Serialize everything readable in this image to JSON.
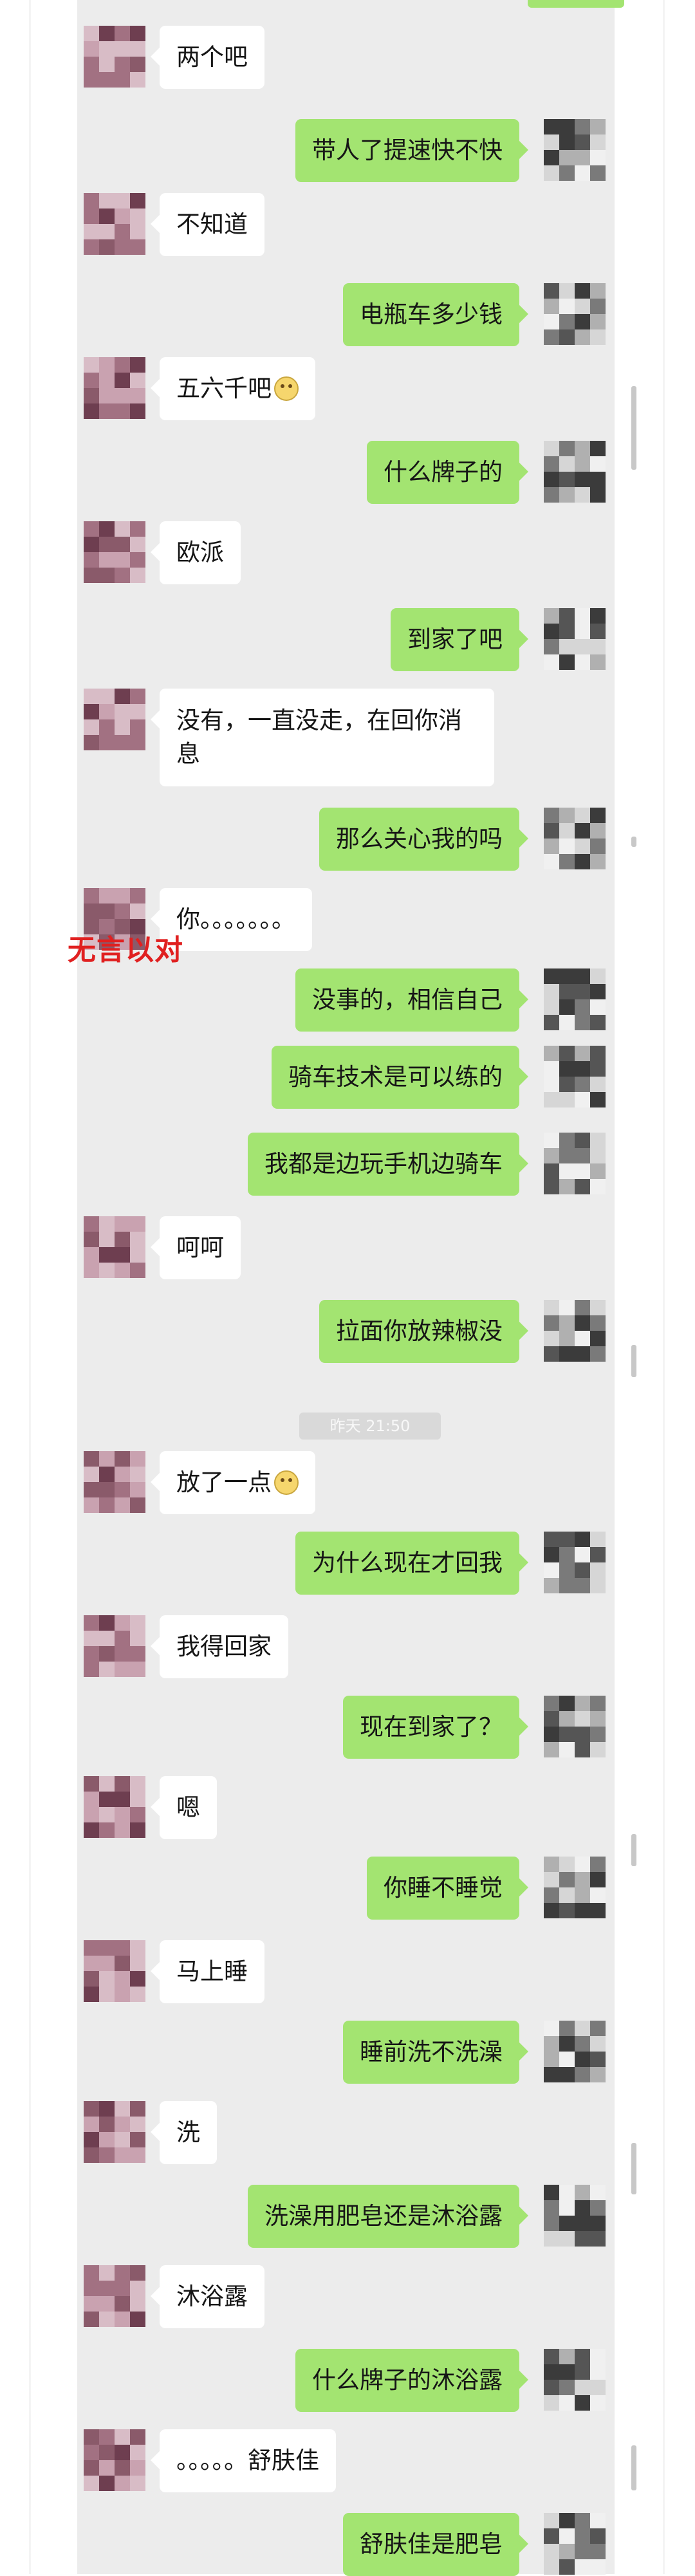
{
  "caption": "无言以对",
  "timestamp": "昨天 21:50",
  "messages": [
    {
      "side": "in",
      "text": "两个吧",
      "emoji": false
    },
    {
      "side": "out",
      "text": "带人了提速快不快"
    },
    {
      "side": "in",
      "text": "不知道"
    },
    {
      "side": "out",
      "text": "电瓶车多少钱"
    },
    {
      "side": "in",
      "text": "五六千吧",
      "emoji": true
    },
    {
      "side": "out",
      "text": "什么牌子的"
    },
    {
      "side": "in",
      "text": "欧派"
    },
    {
      "side": "out",
      "text": "到家了吧"
    },
    {
      "side": "in",
      "text": "没有，一直没走，在回你消息"
    },
    {
      "side": "out",
      "text": "那么关心我的吗"
    },
    {
      "side": "in",
      "text": "你。。。。。。。"
    },
    {
      "side": "out",
      "text": "没事的，相信自己"
    },
    {
      "side": "out",
      "text": "骑车技术是可以练的"
    },
    {
      "side": "out",
      "text": "我都是边玩手机边骑车"
    },
    {
      "side": "in",
      "text": "呵呵"
    },
    {
      "side": "out",
      "text": "拉面你放辣椒没"
    },
    {
      "side": "in",
      "text": "放了一点",
      "emoji": true
    },
    {
      "side": "out",
      "text": "为什么现在才回我"
    },
    {
      "side": "in",
      "text": "我得回家"
    },
    {
      "side": "out",
      "text": "现在到家了？"
    },
    {
      "side": "in",
      "text": "嗯"
    },
    {
      "side": "out",
      "text": "你睡不睡觉"
    },
    {
      "side": "in",
      "text": "马上睡"
    },
    {
      "side": "out",
      "text": "睡前洗不洗澡"
    },
    {
      "side": "in",
      "text": "洗"
    },
    {
      "side": "out",
      "text": "洗澡用肥皂还是沐浴露"
    },
    {
      "side": "in",
      "text": "沐浴露"
    },
    {
      "side": "out",
      "text": "什么牌子的沐浴露"
    },
    {
      "side": "in",
      "text": "。。。。。舒肤佳"
    },
    {
      "side": "out",
      "text": "舒肤佳是肥皂"
    }
  ]
}
